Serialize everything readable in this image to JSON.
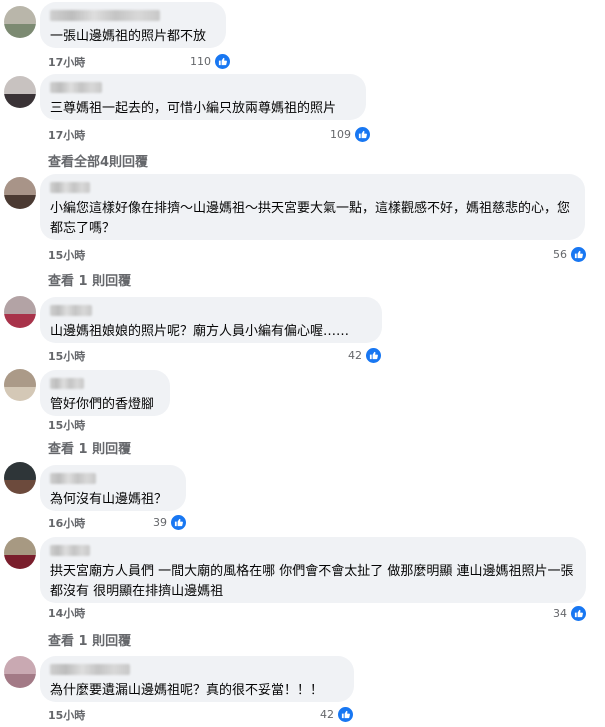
{
  "colors": {
    "accent": "#1877f2",
    "bubble": "#f0f2f5",
    "meta": "#65676b"
  },
  "comments": [
    {
      "text": "一張山邊媽祖的照片都不放",
      "time": "17小時",
      "likes": "110"
    },
    {
      "text": "三尊媽祖一起去的，可惜小編只放兩尊媽祖的照片",
      "time": "17小時",
      "likes": "109",
      "view_replies": "查看全部4則回覆"
    },
    {
      "text": "小編您這樣好像在排擠～山邊媽祖～拱天宮要大氣一點，這樣觀感不好，媽祖慈悲的心，您都忘了嗎？",
      "time": "15小時",
      "likes": "56",
      "view_replies": "查看 1 則回覆"
    },
    {
      "text": "山邊媽祖娘娘的照片呢？廟方人員小編有偏心喔……",
      "time": "15小時",
      "likes": "42"
    },
    {
      "text": "管好你們的香燈腳",
      "time": "15小時",
      "likes": "",
      "view_replies": "查看 1 則回覆"
    },
    {
      "text": "為何沒有山邊媽祖？",
      "time": "16小時",
      "likes": "39"
    },
    {
      "text": "拱天宮廟方人員們 一間大廟的風格在哪 你們會不會太扯了 做那麼明顯 連山邊媽祖照片一張都沒有 很明顯在排擠山邊媽祖",
      "time": "14小時",
      "likes": "34",
      "view_replies": "查看 1 則回覆"
    },
    {
      "text": "為什麼要遺漏山邊媽祖呢？真的很不妥當！！！",
      "time": "15小時",
      "likes": "42"
    }
  ]
}
